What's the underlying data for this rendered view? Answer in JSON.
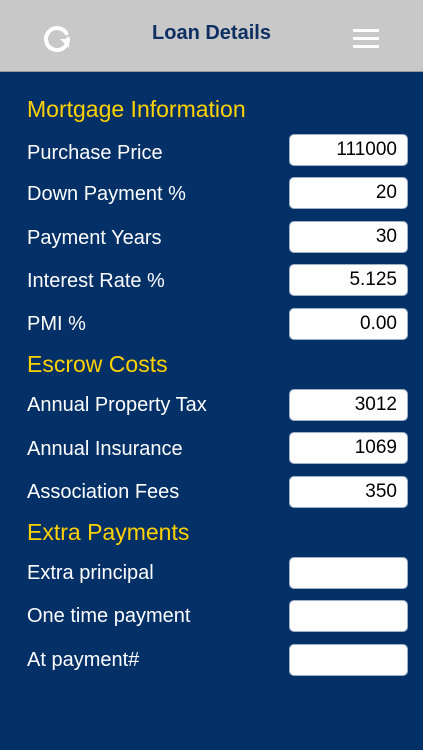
{
  "header": {
    "title": "Loan Details",
    "refresh_icon": "refresh-icon",
    "menu_icon": "hamburger-menu-icon"
  },
  "colors": {
    "background": "#043068",
    "header_background": "#c8c8c8",
    "section_title": "#ffd200",
    "label": "#ffffff",
    "header_title": "#0d2f63"
  },
  "sections": {
    "mortgage": {
      "title": "Mortgage Information",
      "purchase_price": {
        "label": "Purchase Price",
        "value": "111000"
      },
      "down_payment": {
        "label": "Down Payment %",
        "value": "20"
      },
      "payment_years": {
        "label": "Payment Years",
        "value": "30"
      },
      "interest_rate": {
        "label": "Interest Rate %",
        "value": "5.125"
      },
      "pmi": {
        "label": "PMI %",
        "value": "0.00"
      }
    },
    "escrow": {
      "title": "Escrow Costs",
      "property_tax": {
        "label": "Annual Property Tax",
        "value": "3012"
      },
      "insurance": {
        "label": "Annual Insurance",
        "value": "1069"
      },
      "association_fees": {
        "label": "Association Fees",
        "value": "350"
      }
    },
    "extra": {
      "title": "Extra Payments",
      "extra_principal": {
        "label": "Extra principal",
        "value": ""
      },
      "one_time_payment": {
        "label": "One time payment",
        "value": ""
      },
      "at_payment": {
        "label": "At payment#",
        "value": ""
      }
    }
  }
}
